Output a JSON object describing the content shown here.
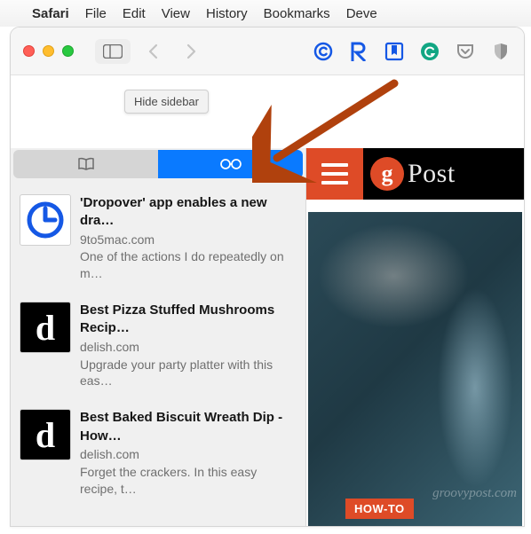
{
  "menubar": {
    "items": [
      "Safari",
      "File",
      "Edit",
      "View",
      "History",
      "Bookmarks",
      "Deve"
    ]
  },
  "toolbar": {
    "tooltip": "Hide sidebar"
  },
  "sidebar": {
    "tabs": {
      "bookmarks_label": "Bookmarks",
      "reading_list_label": "Reading List"
    },
    "items": [
      {
        "title": "'Dropover' app enables a new dra…",
        "domain": "9to5mac.com",
        "preview": "One of the actions I do repeatedly on m…",
        "thumb_kind": "clock"
      },
      {
        "title": "Best Pizza Stuffed Mushrooms Recip…",
        "domain": "delish.com",
        "preview": "Upgrade your party platter with this eas…",
        "thumb_kind": "d"
      },
      {
        "title": "Best Baked Biscuit Wreath Dip - How…",
        "domain": "delish.com",
        "preview": "Forget the crackers. In this easy recipe, t…",
        "thumb_kind": "d"
      }
    ]
  },
  "page": {
    "site_name": "Post",
    "hero_badge": "HOW-TO",
    "watermark": "groovypost.com"
  },
  "colors": {
    "accent_blue": "#0a7aff",
    "site_orange": "#de4b27",
    "arrow": "#b0410d"
  }
}
